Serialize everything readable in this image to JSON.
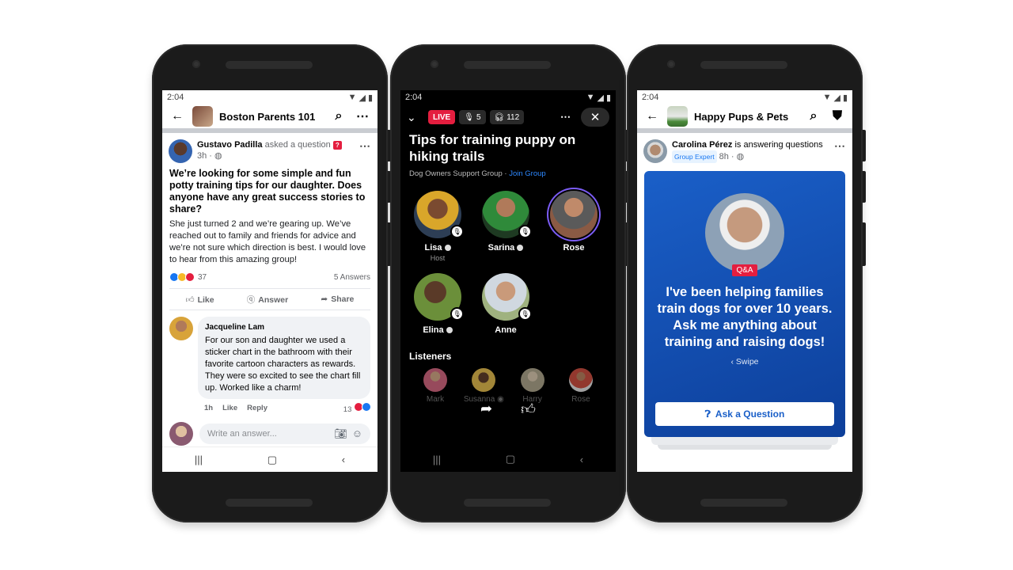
{
  "phones": {
    "group_post": {
      "status_time": "2:04",
      "group_name": "Boston Parents 101",
      "author": "Gustavo Padilla",
      "author_action": "asked a question",
      "post_time": "3h",
      "title": "We’re looking for some simple and fun potty training tips for our daughter. Does anyone have any great success stories to share?",
      "body": "She just turned 2 and we’re gearing up. We’ve reached out to family and friends for advice and we’re not sure which direction is best. I would love to hear from this amazing group!",
      "reaction_count": "37",
      "answers_count": "5 Answers",
      "actions": {
        "like": "Like",
        "answer": "Answer",
        "share": "Share"
      },
      "comment": {
        "author": "Jacqueline Lam",
        "text": "For our son and daughter we used a sticker chart in the bathroom with their favorite cartoon characters as rewards. They were so excited to see the chart fill up. Worked like a charm!",
        "time": "1h",
        "like": "Like",
        "reply": "Reply",
        "reaction_count": "13"
      },
      "answer_placeholder": "Write an answer..."
    },
    "live_audio": {
      "status_time": "2:04",
      "live_label": "LIVE",
      "speaker_count": "5",
      "listener_count": "112",
      "title": "Tips for training puppy on hiking trails",
      "group": "Dog Owners Support Group",
      "join_label": "Join Group",
      "speakers": [
        {
          "name": "Lisa",
          "role": "Host",
          "color": "#d9a62a"
        },
        {
          "name": "Sarina",
          "role": "",
          "color": "#3b7a3c"
        },
        {
          "name": "Rose",
          "role": "",
          "color": "#8a5a44"
        },
        {
          "name": "Elina",
          "role": "",
          "color": "#6b8f3a"
        },
        {
          "name": "Anne",
          "role": "",
          "color": "#9fb27f"
        }
      ],
      "listeners_heading": "Listeners",
      "listeners": [
        {
          "name": "Mark",
          "color": "#c9627a"
        },
        {
          "name": "Susanna",
          "color": "#d8b24a"
        },
        {
          "name": "Harry",
          "color": "#a59e86"
        },
        {
          "name": "Rose",
          "color": "#c24b3e"
        }
      ]
    },
    "expert_qa": {
      "status_time": "2:04",
      "group_name": "Happy Pups & Pets",
      "author": "Carolina Pérez",
      "author_action": "is answering questions",
      "badge": "Group Expert",
      "post_time": "8h",
      "tag": "Q&A",
      "card_text": "I've been helping families train dogs for over 10 years. Ask me anything about training and raising dogs!",
      "swipe_label": "Swipe",
      "ask_button": "Ask a Question"
    }
  },
  "colors": {
    "facebook_blue": "#1877f2",
    "live_red": "#e41e3f",
    "card_blue": "#1a5fc8"
  }
}
